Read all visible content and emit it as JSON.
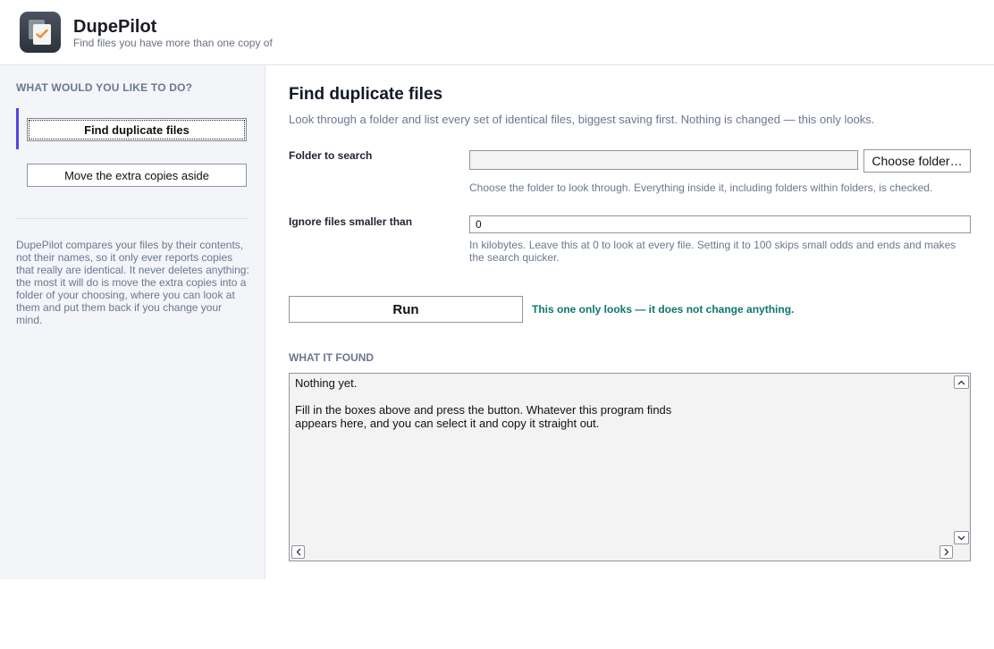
{
  "header": {
    "title": "DupePilot",
    "tagline": "Find files you have more than one copy of"
  },
  "sidebar": {
    "heading": "WHAT WOULD YOU LIKE TO DO?",
    "items": [
      {
        "label": "Find duplicate files",
        "active": true
      },
      {
        "label": "Move the extra copies aside",
        "active": false
      }
    ],
    "note": "DupePilot compares your files by their contents, not their names, so it only ever reports copies that really are identical. It never deletes anything: the most it will do is move the extra copies into a folder of your choosing, where you can look at them and put them back if you change your mind."
  },
  "main": {
    "title": "Find duplicate files",
    "subtitle": "Look through a folder and list every set of identical files, biggest saving first. Nothing is changed — this only looks.",
    "folder": {
      "label": "Folder to search",
      "value": "",
      "button": "Choose folder…",
      "help": "Choose the folder to look through. Everything inside it, including folders within folders, is checked."
    },
    "min_size": {
      "label": "Ignore files smaller than",
      "value": "0",
      "help": "In kilobytes. Leave this at 0 to look at every file. Setting it to 100 skips small odds and ends and makes the search quicker."
    },
    "run_button": "Run",
    "run_note": "This one only looks — it does not change anything.",
    "results": {
      "heading": "WHAT IT FOUND",
      "text": "Nothing yet.\n\nFill in the boxes above and press the button. Whatever this program finds\nappears here, and you can select it and copy it straight out."
    }
  },
  "colors": {
    "accent": "#4f46e5",
    "note_green": "#0f766e",
    "muted_text": "#6b7790"
  }
}
